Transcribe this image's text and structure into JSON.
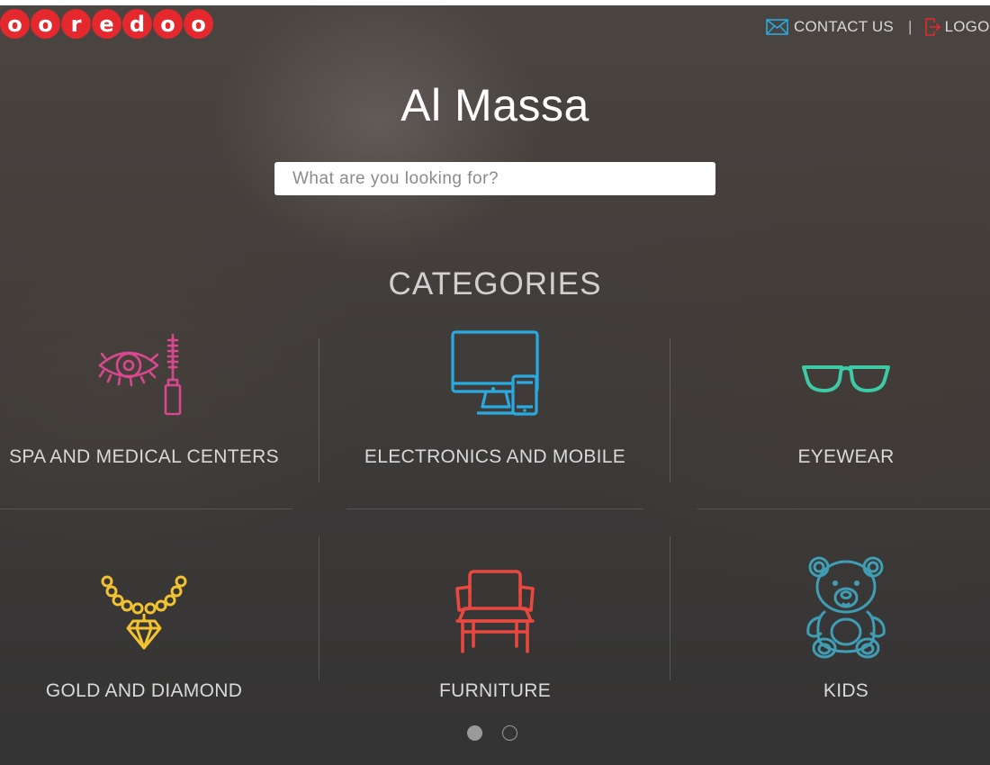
{
  "header": {
    "logo_text": "ooredoo",
    "contact_label": "CONTACT US",
    "logout_label": "LOGO",
    "separator": "|"
  },
  "hero": {
    "title": "Al Massa",
    "search_placeholder": "What are you looking for?"
  },
  "categories": {
    "heading": "CATEGORIES",
    "items": [
      {
        "label": "SPA AND MEDICAL CENTERS",
        "icon": "eye-mascara-icon",
        "color": "#d9488f"
      },
      {
        "label": "ELECTRONICS AND MOBILE",
        "icon": "computer-mobile-icon",
        "color": "#29abe2"
      },
      {
        "label": "EYEWEAR",
        "icon": "glasses-icon",
        "color": "#3ec9a7"
      },
      {
        "label": "GOLD AND DIAMOND",
        "icon": "necklace-icon",
        "color": "#f2c230"
      },
      {
        "label": "FURNITURE",
        "icon": "armchair-icon",
        "color": "#e8483f"
      },
      {
        "label": "KIDS",
        "icon": "teddy-bear-icon",
        "color": "#3f9db4"
      }
    ]
  },
  "pagination": {
    "pages": 2,
    "current": 1
  },
  "colors": {
    "brand_red": "#e5282d",
    "contact_icon": "#29abe2",
    "logout_icon": "#e5282d"
  }
}
